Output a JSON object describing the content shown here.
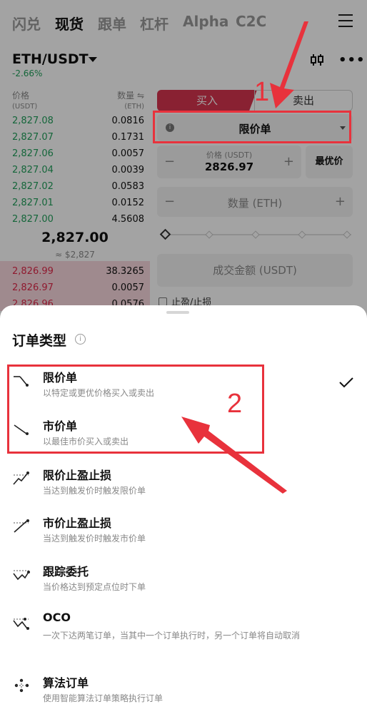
{
  "topnav": {
    "tabs": [
      "闪兑",
      "现货",
      "跟单",
      "杠杆",
      "Alpha",
      "C2C"
    ],
    "active_index": 1
  },
  "market": {
    "pair": "ETH/USDT",
    "change": "-2.66%"
  },
  "orderbook": {
    "price_header": "价格",
    "price_unit": "(USDT)",
    "qty_header": "数量 ⇋",
    "qty_unit": "(ETH)",
    "bids": [
      {
        "price": "2,827.08",
        "qty": "0.0816"
      },
      {
        "price": "2,827.07",
        "qty": "0.1731"
      },
      {
        "price": "2,827.06",
        "qty": "0.0057"
      },
      {
        "price": "2,827.04",
        "qty": "0.0039"
      },
      {
        "price": "2,827.02",
        "qty": "0.0583"
      },
      {
        "price": "2,827.01",
        "qty": "0.0152"
      },
      {
        "price": "2,827.00",
        "qty": "4.5608"
      }
    ],
    "mid_price": "2,827.00",
    "mid_fiat": "≈ $2,827",
    "asks": [
      {
        "price": "2,826.99",
        "qty": "38.3265"
      },
      {
        "price": "2,826.97",
        "qty": "0.0057"
      },
      {
        "price": "2,826.96",
        "qty": "0.0576"
      }
    ]
  },
  "trade_panel": {
    "buy_label": "买入",
    "sell_label": "卖出",
    "order_type": "限价单",
    "price_caption": "价格 (USDT)",
    "price_value": "2826.97",
    "best_price": "最优价",
    "qty_placeholder": "数量 (ETH)",
    "total_placeholder": "成交金额 (USDT)",
    "tpsl_label": "止盈/止损"
  },
  "sheet": {
    "title": "订单类型",
    "options": [
      {
        "name": "限价单",
        "desc": "以特定或更优价格买入或卖出",
        "icon": "limit-order-icon",
        "selected": true
      },
      {
        "name": "市价单",
        "desc": "以最佳市价买入或卖出",
        "icon": "market-order-icon",
        "selected": false
      },
      {
        "name": "限价止盈止损",
        "desc": "当达到触发价时触发限价单",
        "icon": "stop-limit-icon",
        "selected": false
      },
      {
        "name": "市价止盈止损",
        "desc": "当达到触发价时触发市价单",
        "icon": "stop-market-icon",
        "selected": false
      },
      {
        "name": "跟踪委托",
        "desc": "当价格达到预定点位时下单",
        "icon": "trailing-icon",
        "selected": false
      },
      {
        "name": "OCO",
        "desc": "一次下达两笔订单，当其中一个订单执行时，另一个订单将自动取消",
        "icon": "oco-icon",
        "selected": false
      },
      {
        "name": "算法订单",
        "desc": "使用智能算法订单策略执行订单",
        "icon": "algo-icon",
        "selected": false
      }
    ]
  },
  "annotations": {
    "step1": "1",
    "step2": "2",
    "color": "#e8323c"
  },
  "colors": {
    "buy": "#d6344f",
    "bid_text": "#21a05c",
    "ask_text": "#e0294a"
  }
}
